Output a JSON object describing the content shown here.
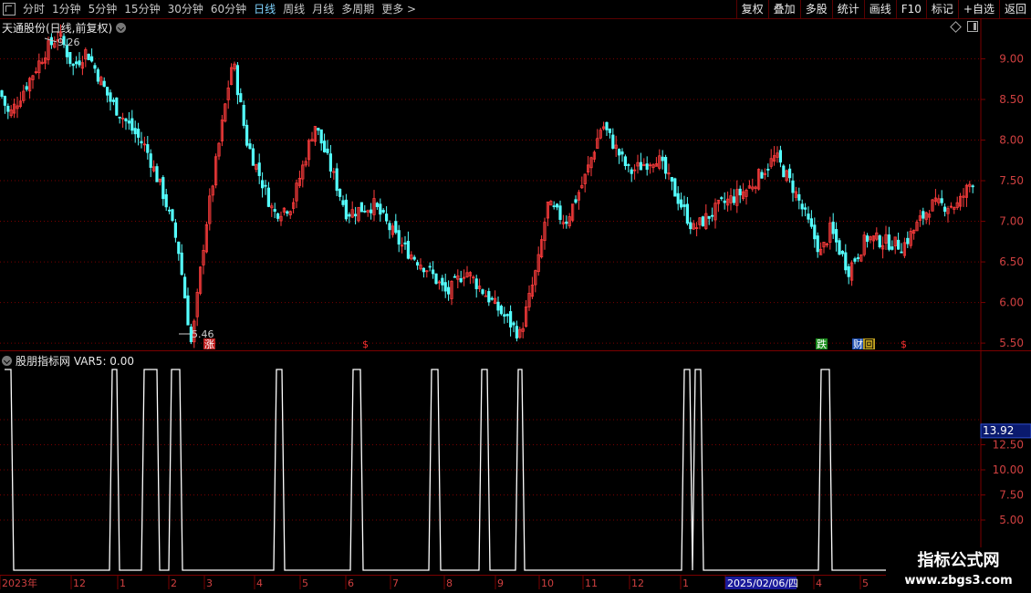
{
  "toolbar": {
    "left": [
      {
        "label": "分时",
        "active": false
      },
      {
        "label": "1分钟",
        "active": false
      },
      {
        "label": "5分钟",
        "active": false
      },
      {
        "label": "15分钟",
        "active": false
      },
      {
        "label": "30分钟",
        "active": false
      },
      {
        "label": "60分钟",
        "active": false
      },
      {
        "label": "日线",
        "active": true
      },
      {
        "label": "周线",
        "active": false
      },
      {
        "label": "月线",
        "active": false
      },
      {
        "label": "多周期",
        "active": false
      },
      {
        "label": "更多 >",
        "active": false
      }
    ],
    "right": [
      "复权",
      "叠加",
      "多股",
      "统计",
      "画线",
      "F10",
      "标记",
      "+自选",
      "返回"
    ]
  },
  "stock": {
    "title": "天通股份(日线,前复权)"
  },
  "annotations": {
    "high": "9.26",
    "low": "5.46",
    "zhang": "涨",
    "die": "跌",
    "cai": "财",
    "hui": "回",
    "s": "$"
  },
  "indicator": {
    "title": "股朋指标网 VAR5: 0.00",
    "current_value": "13.92"
  },
  "axis_labels": {
    "price": [
      "9.00",
      "8.50",
      "8.00",
      "7.50",
      "7.00",
      "6.50",
      "6.00",
      "5.50"
    ],
    "indicator": [
      "12.50",
      "10.00",
      "7.50",
      "5.00"
    ],
    "dates": [
      "2023年",
      "12",
      "1",
      "2",
      "3",
      "4",
      "5",
      "6",
      "7",
      "8",
      "9",
      "10",
      "11",
      "12",
      "1",
      "2025/02/06/四",
      "4",
      "5"
    ]
  },
  "colors": {
    "up": "#ff3c3c",
    "down": "#54ffff",
    "accent": "#7fd4ff",
    "grid": "#7a0000"
  },
  "watermark": {
    "line1": "指标公式网",
    "line2": "www.zbgs3.com"
  },
  "chart_data": [
    {
      "type": "candlestick",
      "title": "天通股份(日线,前复权)",
      "y_ticks": [
        9.0,
        8.5,
        8.0,
        7.5,
        7.0,
        6.5,
        6.0,
        5.5
      ],
      "ylim": [
        5.4,
        9.5
      ],
      "close_path_x": [
        0,
        10,
        25,
        50,
        65,
        80,
        95,
        120,
        140,
        160,
        180,
        195,
        210,
        225,
        235,
        255,
        270,
        300,
        320,
        345,
        380,
        410,
        440,
        470,
        490,
        510,
        540,
        570,
        590,
        600,
        620,
        640,
        660,
        690,
        720,
        760,
        790,
        820,
        850,
        870,
        900,
        910,
        930,
        950,
        990,
        1020,
        1050,
        1065
      ],
      "close_path_y": [
        8.6,
        8.3,
        8.6,
        9.1,
        9.3,
        8.9,
        9.1,
        8.5,
        8.2,
        7.9,
        7.3,
        6.7,
        5.46,
        6.9,
        7.6,
        9.0,
        8.0,
        7.1,
        7.2,
        8.2,
        7.1,
        7.2,
        6.7,
        6.4,
        6.1,
        6.4,
        6.0,
        5.6,
        6.5,
        7.2,
        7.0,
        7.5,
        8.2,
        7.6,
        7.8,
        6.9,
        7.2,
        7.4,
        7.8,
        7.4,
        6.6,
        6.9,
        6.4,
        6.8,
        6.7,
        7.2,
        7.2,
        7.5
      ],
      "extremes": {
        "high": 9.26,
        "low": 5.46
      }
    },
    {
      "type": "line",
      "title": "股朋指标网 VAR5",
      "y_ticks": [
        12.5,
        10.0,
        7.5,
        5.0
      ],
      "ylim": [
        0,
        20
      ],
      "pulses_x": [
        [
          12,
          125
        ],
        [
          158,
          172
        ],
        [
          188,
          197
        ],
        [
          303,
          309
        ],
        [
          387,
          395
        ],
        [
          473,
          480
        ],
        [
          528,
          534
        ],
        [
          568,
          572
        ],
        [
          750,
          756
        ],
        [
          762,
          768
        ],
        [
          900,
          909
        ]
      ],
      "pulse_value": 20,
      "baseline": 0,
      "current": 13.92
    }
  ]
}
